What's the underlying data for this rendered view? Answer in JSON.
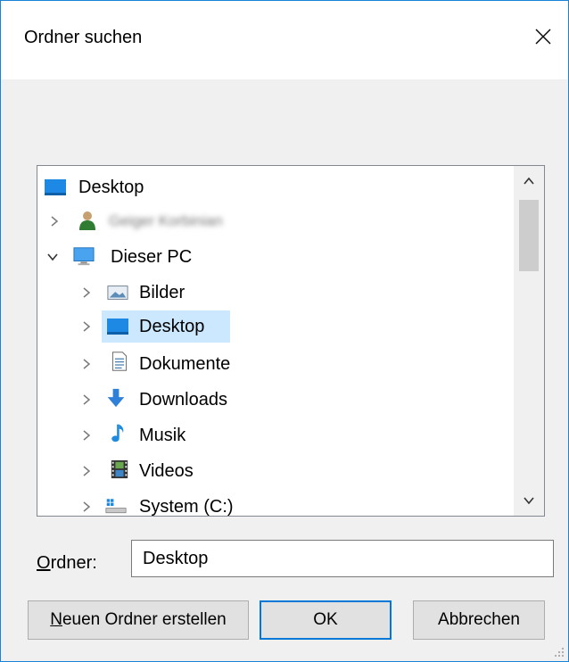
{
  "dialog": {
    "title": "Ordner suchen",
    "close_glyph": "×"
  },
  "tree": {
    "items": [
      {
        "label": "Desktop",
        "icon": "desktop-icon",
        "expand": "none"
      },
      {
        "label": "Geiger Korbinian",
        "icon": "user-icon",
        "expand": "collapsed"
      },
      {
        "label": "Dieser PC",
        "icon": "computer-icon",
        "expand": "expanded"
      },
      {
        "label": "Bilder",
        "icon": "pictures-icon",
        "expand": "collapsed"
      },
      {
        "label": "Desktop",
        "icon": "desktop-icon",
        "expand": "collapsed",
        "selected": true
      },
      {
        "label": "Dokumente",
        "icon": "documents-icon",
        "expand": "collapsed"
      },
      {
        "label": "Downloads",
        "icon": "downloads-icon",
        "expand": "collapsed"
      },
      {
        "label": "Musik",
        "icon": "music-icon",
        "expand": "collapsed"
      },
      {
        "label": "Videos",
        "icon": "videos-icon",
        "expand": "collapsed"
      },
      {
        "label": "System (C:)",
        "icon": "drive-icon",
        "expand": "collapsed"
      }
    ]
  },
  "folder_field": {
    "label_prefix": "O",
    "label_rest": "rdner:",
    "value": "Desktop"
  },
  "buttons": {
    "new_folder_prefix": "N",
    "new_folder_rest": "euen Ordner erstellen",
    "ok": "OK",
    "cancel": "Abbrechen"
  },
  "colors": {
    "accent": "#0078d7",
    "selection": "#cce8ff",
    "window_border": "#1883d7"
  }
}
